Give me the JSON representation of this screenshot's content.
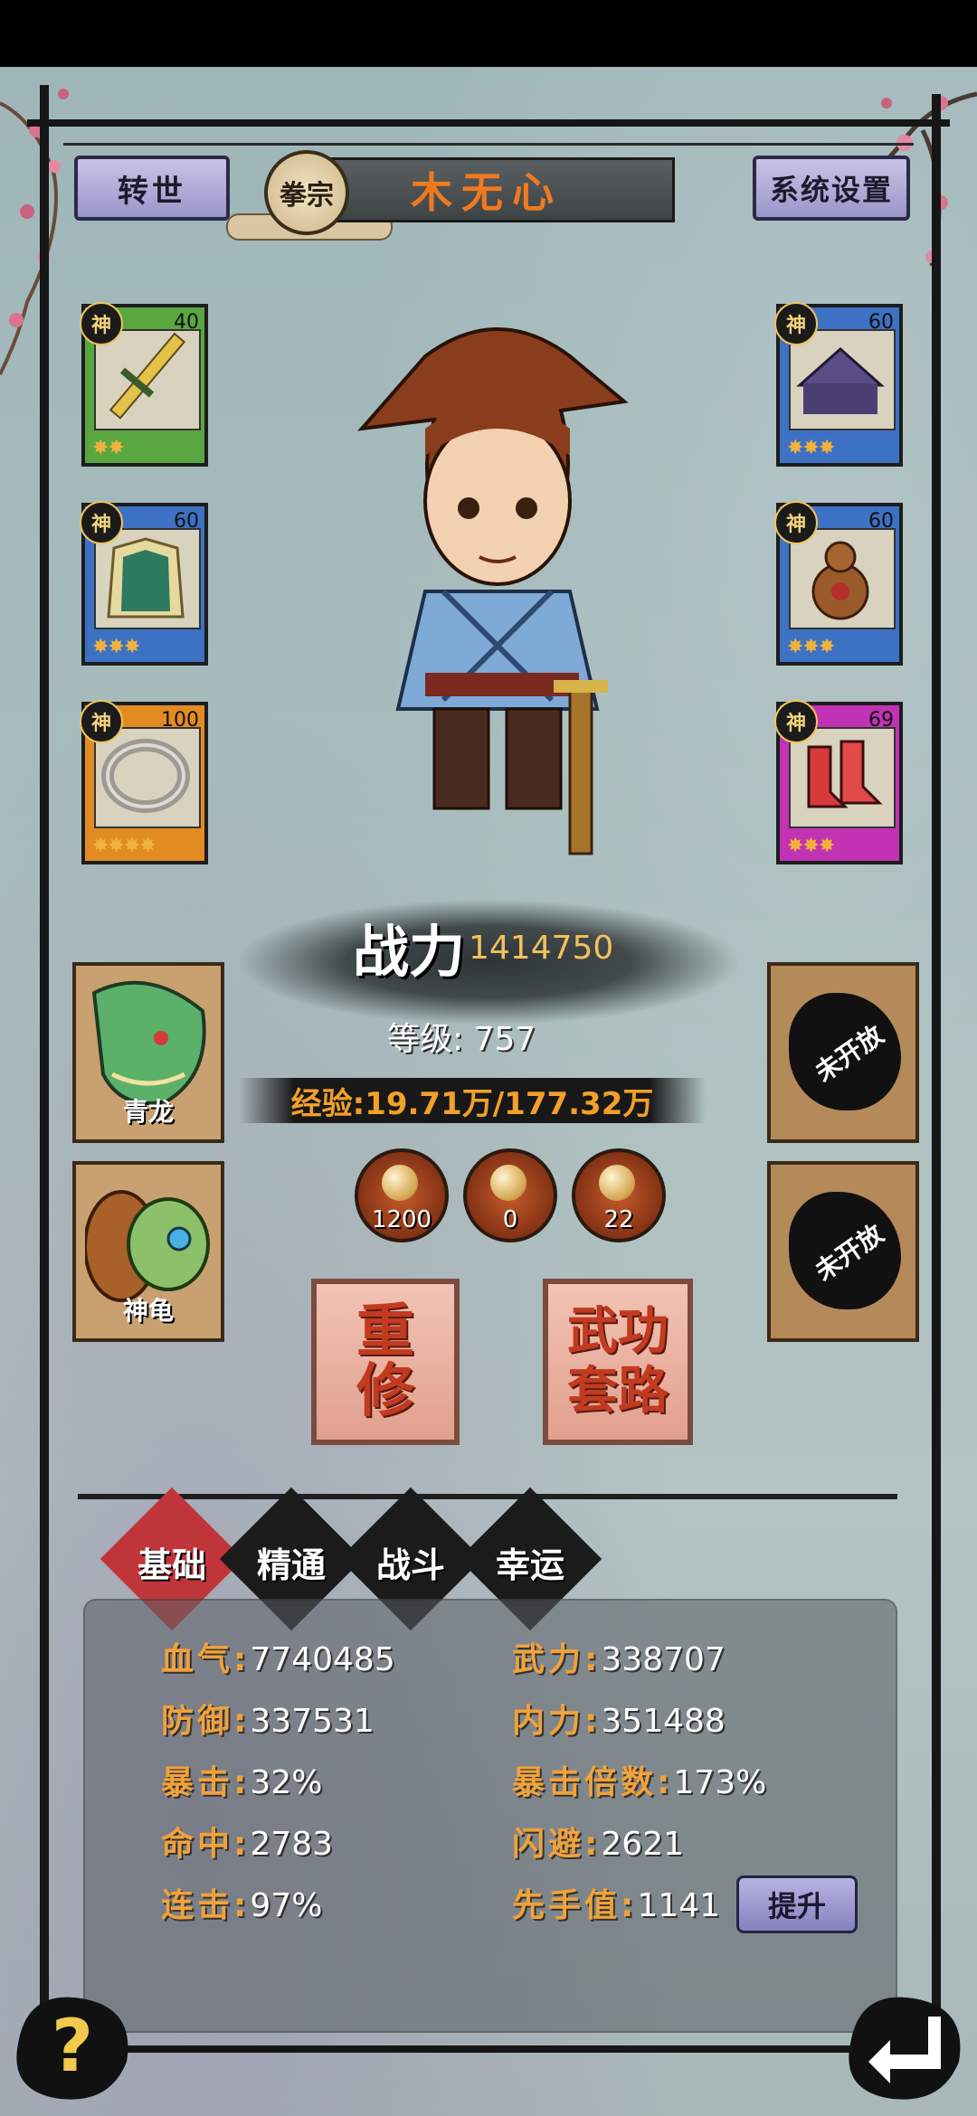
{
  "header": {
    "reincarnate_label": "转世",
    "settings_label": "系统设置",
    "sect": "拳宗",
    "player_name": "木无心"
  },
  "equipment": {
    "left": [
      {
        "tag": "神",
        "level": "40",
        "stars": "✸✸",
        "slot": "sword"
      },
      {
        "tag": "神",
        "level": "60",
        "stars": "✸✸✸",
        "slot": "armor"
      },
      {
        "tag": "神",
        "level": "100",
        "stars": "✸✸✸✸",
        "slot": "ring"
      }
    ],
    "right": [
      {
        "tag": "神",
        "level": "60",
        "stars": "✸✸✸",
        "slot": "hat"
      },
      {
        "tag": "神",
        "level": "60",
        "stars": "✸✸✸",
        "slot": "gourd"
      },
      {
        "tag": "神",
        "level": "69",
        "stars": "✸✸✸",
        "slot": "boots"
      }
    ]
  },
  "hero": {
    "power_label": "战力",
    "power_value": "1414750",
    "level_text": "等级: 757",
    "exp_text": "经验:19.71万/177.32万"
  },
  "items": [
    {
      "count": "1200"
    },
    {
      "count": "0"
    },
    {
      "count": "22"
    }
  ],
  "pets": [
    {
      "name": "青龙"
    },
    {
      "name": "神龟"
    }
  ],
  "locked_slots": [
    {
      "label": "未开放"
    },
    {
      "label": "未开放"
    }
  ],
  "actions": {
    "retrain_label": "重修",
    "martial_label": "武功套路"
  },
  "tabs": [
    {
      "label": "基础",
      "active": true
    },
    {
      "label": "精通",
      "active": false
    },
    {
      "label": "战斗",
      "active": false
    },
    {
      "label": "幸运",
      "active": false
    }
  ],
  "stats": {
    "hp": {
      "k": "血气:",
      "v": "7740485"
    },
    "atk": {
      "k": "武力:",
      "v": "338707"
    },
    "def": {
      "k": "防御:",
      "v": "337531"
    },
    "inner": {
      "k": "内力:",
      "v": "351488"
    },
    "crit": {
      "k": "暴击:",
      "v": "32%"
    },
    "critmul": {
      "k": "暴击倍数:",
      "v": "173%"
    },
    "hit": {
      "k": "命中:",
      "v": "2783"
    },
    "dodge": {
      "k": "闪避:",
      "v": "2621"
    },
    "combo": {
      "k": "连击:",
      "v": "97%"
    },
    "initiative": {
      "k": "先手值:",
      "v": "1141"
    }
  },
  "upgrade_label": "提升",
  "icons": {
    "help": "help-icon",
    "back": "back-icon"
  }
}
